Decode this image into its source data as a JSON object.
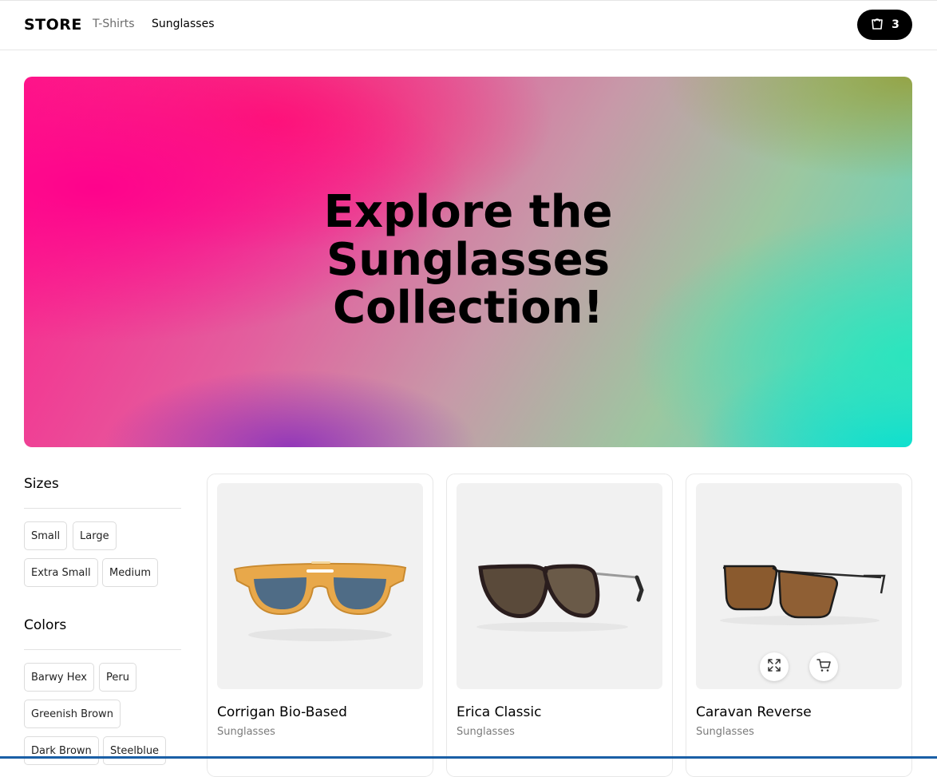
{
  "navbar": {
    "logo": "STORE",
    "links": [
      "T-Shirts",
      "Sunglasses"
    ],
    "cart_count": "3"
  },
  "hero": {
    "title": "Explore the Sunglasses Collection!"
  },
  "filters": {
    "sizes": {
      "title": "Sizes",
      "options": [
        "Small",
        "Large",
        "Extra Small",
        "Medium"
      ]
    },
    "colors": {
      "title": "Colors",
      "options": [
        "Barwy Hex",
        "Peru",
        "Greenish Brown",
        "Dark Brown",
        "Steelblue"
      ]
    }
  },
  "products": [
    {
      "name": "Corrigan Bio-Based",
      "category": "Sunglasses"
    },
    {
      "name": "Erica Classic",
      "category": "Sunglasses"
    },
    {
      "name": "Caravan Reverse",
      "category": "Sunglasses"
    }
  ],
  "icons": {
    "cart": "shopping-bag-icon",
    "expand": "expand-icon",
    "add_to_cart": "cart-icon"
  },
  "colors": {
    "cart_button_bg": "#000000",
    "tile_bg": "#f1f1f1"
  }
}
